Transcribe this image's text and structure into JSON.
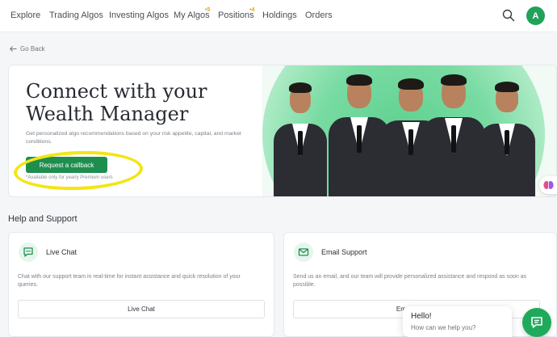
{
  "nav": {
    "items": [
      {
        "label": "Explore",
        "badge": ""
      },
      {
        "label": "Trading Algos",
        "badge": ""
      },
      {
        "label": "Investing Algos",
        "badge": ""
      },
      {
        "label": "My Algos",
        "badge": "5"
      },
      {
        "label": "Positions",
        "badge": "4"
      },
      {
        "label": "Holdings",
        "badge": ""
      },
      {
        "label": "Orders",
        "badge": ""
      }
    ],
    "avatar_initial": "A"
  },
  "back": {
    "label": "Go Back"
  },
  "hero": {
    "title": "Connect with your Wealth Manager",
    "subtitle": "Get personalized algo recommendations based on your risk appetite, capital, and market conditions.",
    "cta_label": "Request a callback",
    "note": "*Available only for yearly Premium users"
  },
  "support": {
    "title": "Help and Support",
    "cards": [
      {
        "title": "Live Chat",
        "icon": "chat-icon",
        "description": "Chat with our support team in real-time for instant assistance and quick resolution of your queries.",
        "button": "Live Chat"
      },
      {
        "title": "Email Support",
        "icon": "mail-icon",
        "description": "Send us an email, and our team will provide personalized assistance and respond as soon as possible.",
        "button": "Email Support"
      }
    ]
  },
  "chat_widget": {
    "hello": "Hello!",
    "help": "How can we help you?"
  },
  "colors": {
    "brand_green": "#1e8e4f",
    "badge_orange": "#e0a21c",
    "highlight_yellow": "#f3e515"
  }
}
